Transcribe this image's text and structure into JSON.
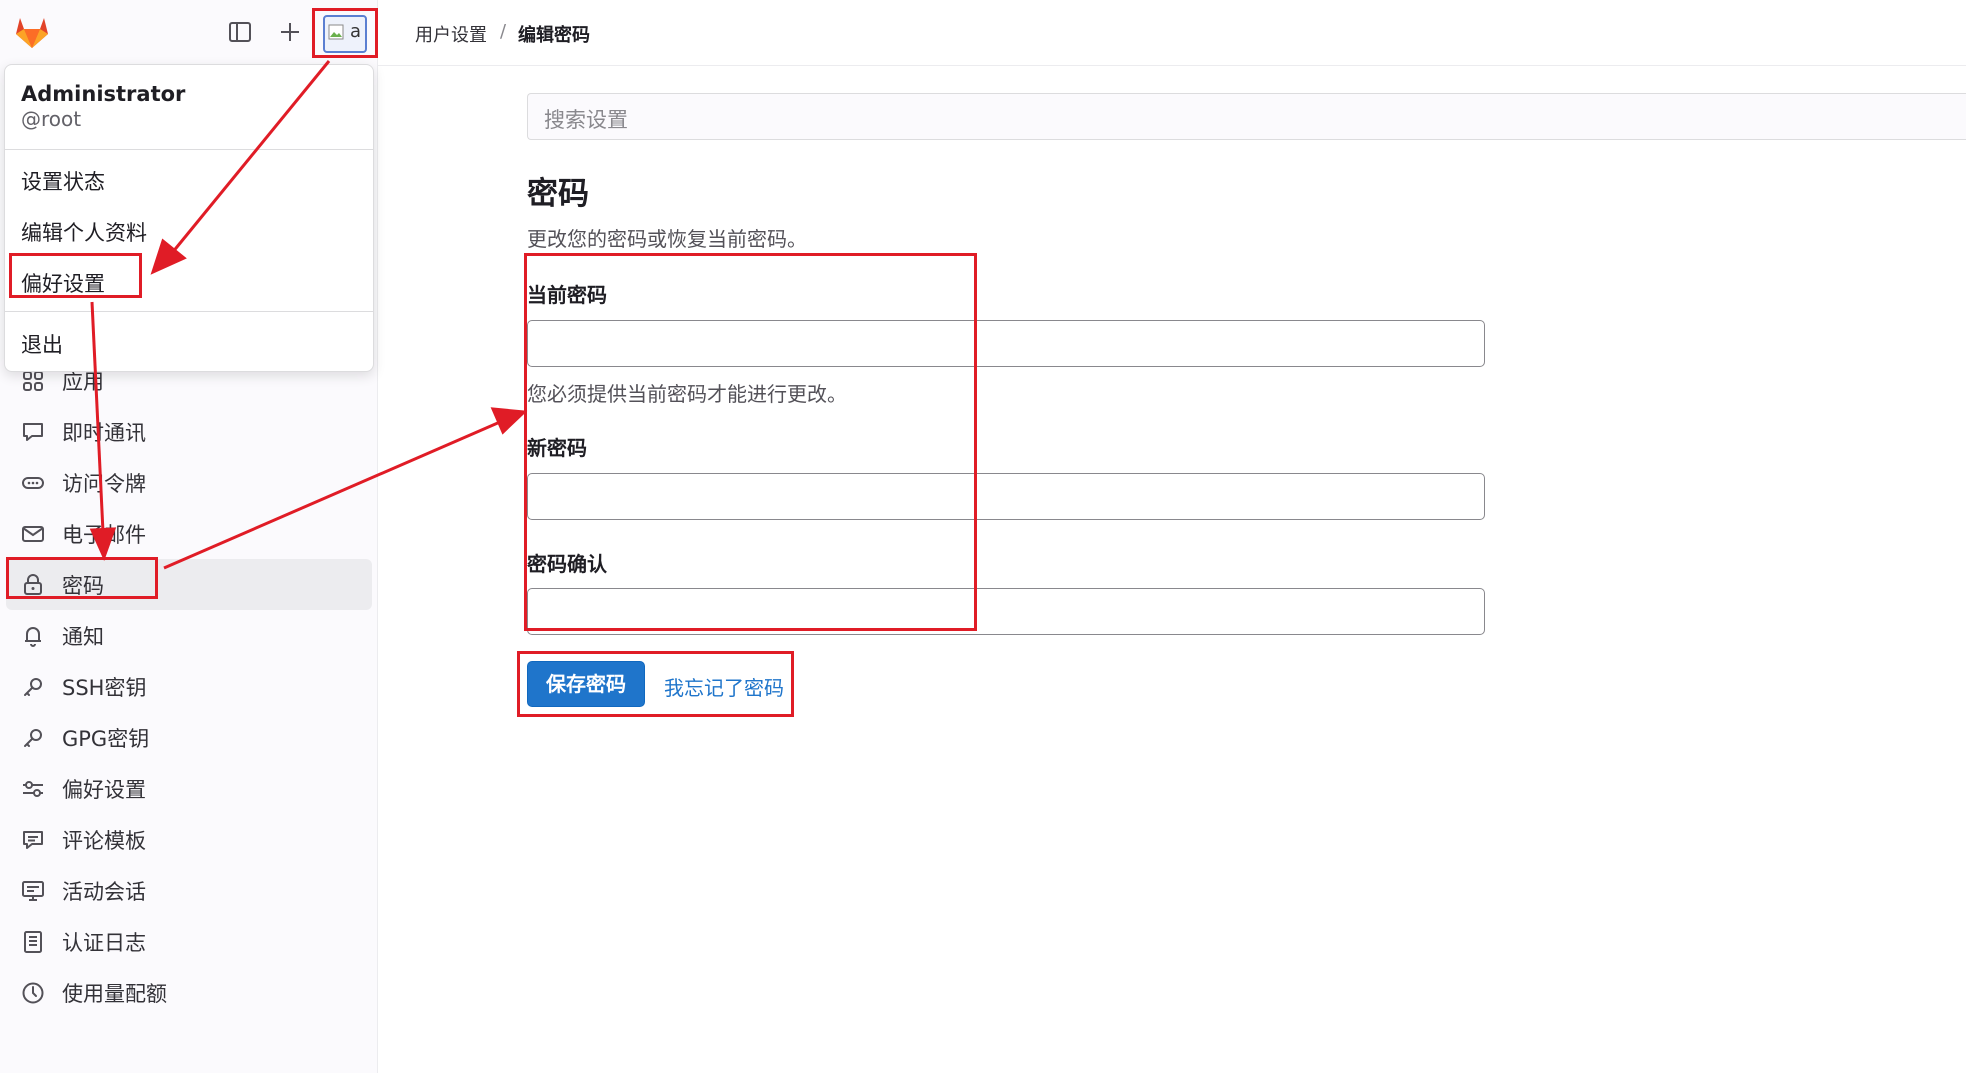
{
  "breadcrumb": {
    "parent": "用户设置",
    "separator": "/",
    "current": "编辑密码"
  },
  "user_menu": {
    "name": "Administrator",
    "username": "@root",
    "items": [
      "设置状态",
      "编辑个人资料",
      "偏好设置",
      "退出"
    ],
    "avatar_alt": "a"
  },
  "sidebar": {
    "items": [
      {
        "label": "应用",
        "icon": "apps-icon"
      },
      {
        "label": "即时通讯",
        "icon": "comment-icon"
      },
      {
        "label": "访问令牌",
        "icon": "token-icon"
      },
      {
        "label": "电子邮件",
        "icon": "mail-icon"
      },
      {
        "label": "密码",
        "icon": "lock-icon",
        "active": true
      },
      {
        "label": "通知",
        "icon": "bell-icon"
      },
      {
        "label": "SSH密钥",
        "icon": "key-icon"
      },
      {
        "label": "GPG密钥",
        "icon": "key-icon"
      },
      {
        "label": "偏好设置",
        "icon": "preferences-icon"
      },
      {
        "label": "评论模板",
        "icon": "comment-template-icon"
      },
      {
        "label": "活动会话",
        "icon": "monitor-icon"
      },
      {
        "label": "认证日志",
        "icon": "log-icon"
      },
      {
        "label": "使用量配额",
        "icon": "quota-icon"
      }
    ]
  },
  "search": {
    "placeholder": "搜索设置"
  },
  "password_form": {
    "title": "密码",
    "description": "更改您的密码或恢复当前密码。",
    "current_label": "当前密码",
    "current_help": "您必须提供当前密码才能进行更改。",
    "new_label": "新密码",
    "confirm_label": "密码确认",
    "save_button": "保存密码",
    "forgot_link": "我忘记了密码"
  },
  "colors": {
    "accent": "#1f75cb",
    "annotation": "#e01c26",
    "brand": "#e24329"
  }
}
